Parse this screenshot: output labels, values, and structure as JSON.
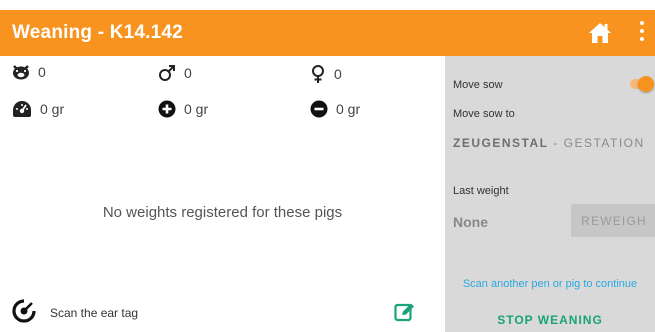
{
  "header": {
    "title": "Weaning - K14.142",
    "home_icon": "home-icon",
    "menu_icon": "more-vert-icon",
    "color": "#f7931e"
  },
  "stats": {
    "total_count": "0",
    "male_count": "0",
    "female_count": "0",
    "avg_weight": "0 gr",
    "plus_weight": "0 gr",
    "minus_weight": "0 gr"
  },
  "main": {
    "empty_message": "No weights registered for these pigs"
  },
  "scan": {
    "label": "Scan the ear tag"
  },
  "side": {
    "move_sow_label": "Move sow",
    "move_sow_enabled": true,
    "move_sow_to_label": "Move sow to",
    "destination_bold": "ZEUGENSTAL",
    "destination_rest": " - GESTATION",
    "last_weight_label": "Last weight",
    "last_weight_value": "None",
    "reweigh_label": "REWEIGH",
    "scan_another": "Scan another pen or pig to continue",
    "stop_label": "STOP WEANING",
    "accent_blue": "#2aa9e0",
    "accent_green": "#1aa37a"
  }
}
